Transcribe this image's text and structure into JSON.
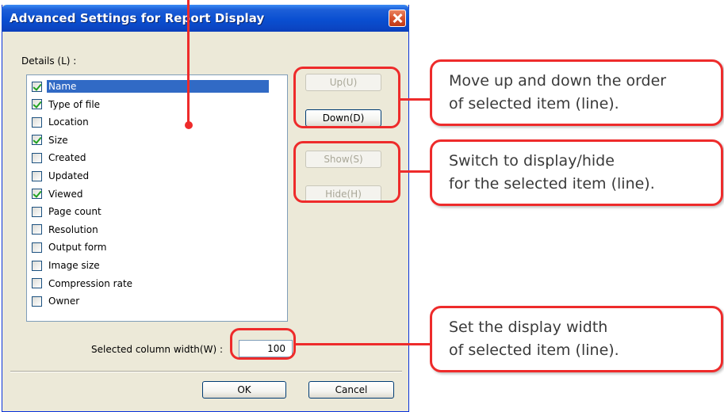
{
  "dialog": {
    "title": "Advanced Settings for Report Display",
    "details_label": "Details (L) :",
    "items": [
      {
        "label": "Name",
        "checked": true,
        "selected": true
      },
      {
        "label": "Type of file",
        "checked": true,
        "selected": false
      },
      {
        "label": "Location",
        "checked": false,
        "selected": false
      },
      {
        "label": "Size",
        "checked": true,
        "selected": false
      },
      {
        "label": "Created",
        "checked": false,
        "selected": false
      },
      {
        "label": "Updated",
        "checked": false,
        "selected": false
      },
      {
        "label": "Viewed",
        "checked": true,
        "selected": false
      },
      {
        "label": "Page count",
        "checked": false,
        "selected": false
      },
      {
        "label": "Resolution",
        "checked": false,
        "selected": false
      },
      {
        "label": "Output form",
        "checked": false,
        "selected": false
      },
      {
        "label": "Image size",
        "checked": false,
        "selected": false
      },
      {
        "label": "Compression rate",
        "checked": false,
        "selected": false
      },
      {
        "label": "Owner",
        "checked": false,
        "selected": false
      }
    ],
    "buttons": {
      "up": "Up(U)",
      "down": "Down(D)",
      "show": "Show(S)",
      "hide": "Hide(H)",
      "ok": "OK",
      "cancel": "Cancel"
    },
    "width_label": "Selected column width(W) :",
    "width_value": "100"
  },
  "callouts": {
    "order_line1": "Move up and down the order",
    "order_line2": "of selected item (line).",
    "display_line1": "Switch to display/hide",
    "display_line2": "for the selected item (line).",
    "width_line1": "Set the display width",
    "width_line2": " of selected item (line)."
  },
  "colors": {
    "highlight": "#ee2b2b",
    "title_bar": "#0a4fd1",
    "dialog_bg": "#ece9d8",
    "selection": "#316ac5"
  }
}
